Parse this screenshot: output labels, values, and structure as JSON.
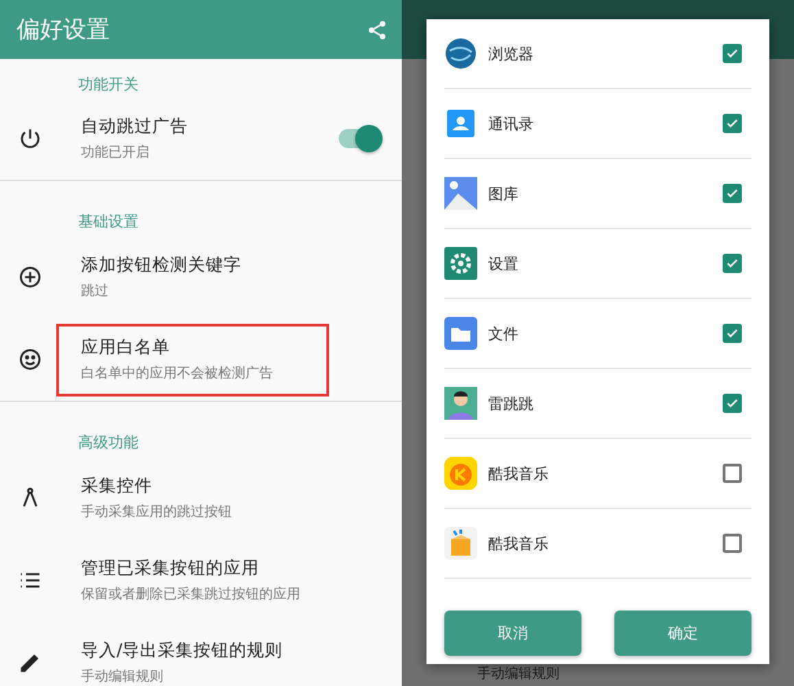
{
  "app_bar": {
    "title": "偏好设置"
  },
  "sections": [
    {
      "header": "功能开关",
      "items": [
        {
          "kind": "switch",
          "title": "自动跳过广告",
          "subtitle": "功能已开启",
          "on": true,
          "highlighted": false
        }
      ]
    },
    {
      "header": "基础设置",
      "items": [
        {
          "kind": "plain",
          "title": "添加按钮检测关键字",
          "subtitle": "跳过",
          "highlighted": false
        },
        {
          "kind": "plain",
          "title": "应用白名单",
          "subtitle": "白名单中的应用不会被检测广告",
          "highlighted": true
        }
      ]
    },
    {
      "header": "高级功能",
      "items": [
        {
          "kind": "plain",
          "title": "采集控件",
          "subtitle": "手动采集应用的跳过按钮",
          "highlighted": false
        },
        {
          "kind": "plain",
          "title": "管理已采集按钮的应用",
          "subtitle": "保留或者删除已采集跳过按钮的应用",
          "highlighted": false
        },
        {
          "kind": "plain",
          "title": "导入/导出采集按钮的规则",
          "subtitle": "手动编辑规则",
          "highlighted": false
        }
      ]
    }
  ],
  "dialog": {
    "apps": [
      {
        "name": "浏览器",
        "checked": true
      },
      {
        "name": "通讯录",
        "checked": true
      },
      {
        "name": "图库",
        "checked": true
      },
      {
        "name": "设置",
        "checked": true
      },
      {
        "name": "文件",
        "checked": true
      },
      {
        "name": "雷跳跳",
        "checked": true
      },
      {
        "name": "酷我音乐",
        "checked": false
      },
      {
        "name": "酷我音乐",
        "checked": false
      }
    ],
    "buttons": [
      {
        "label": "取消"
      },
      {
        "label": "确定"
      }
    ]
  },
  "background_text": "手动编辑规则"
}
